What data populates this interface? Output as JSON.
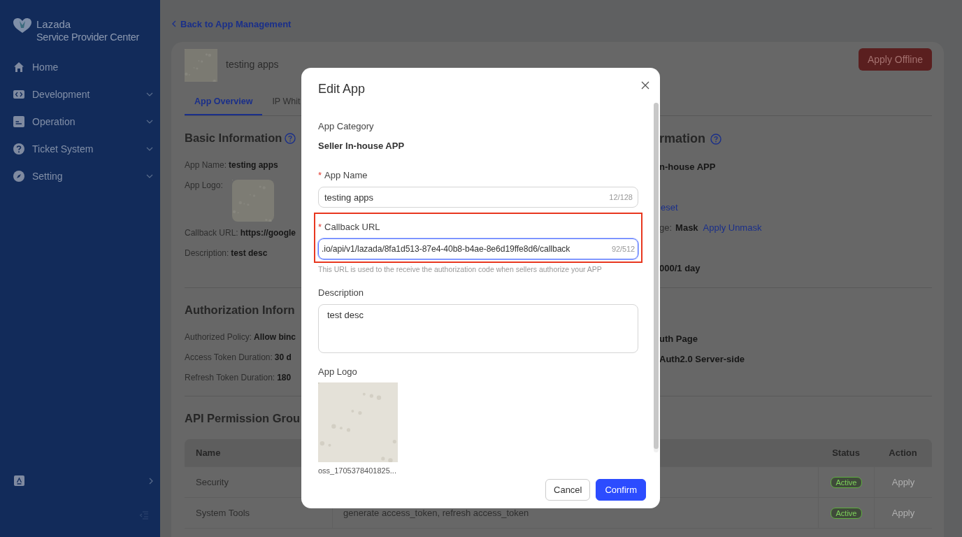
{
  "sidebar": {
    "brand": [
      "Lazada",
      "Service Provider Center"
    ],
    "items": [
      {
        "label": "Home",
        "expandable": false
      },
      {
        "label": "Development",
        "expandable": true
      },
      {
        "label": "Operation",
        "expandable": true
      },
      {
        "label": "Ticket System",
        "expandable": true
      },
      {
        "label": "Setting",
        "expandable": true
      }
    ]
  },
  "back_link": "Back to App Management",
  "app": {
    "name": "testing apps",
    "action": "Apply Offline"
  },
  "tabs": [
    {
      "label": "App Overview",
      "selected": true
    },
    {
      "label": "IP Whit",
      "selected": false
    }
  ],
  "basic_information": {
    "title": "Basic Information",
    "fields": [
      {
        "label": "App Name:",
        "value": "testing apps"
      },
      {
        "label": "App Logo:",
        "kind": "picture"
      },
      {
        "label": "Callback URL:",
        "value": "https://google"
      },
      {
        "label": "Description:",
        "value": "test desc"
      }
    ],
    "right_heading": "rmation",
    "right_rows": [
      {
        "value": "n-house APP"
      },
      {
        "link": "eset"
      },
      {
        "label": "ge:",
        "value": "Mask",
        "link": "Apply Unmask"
      },
      {
        "value": "000/1 day"
      }
    ]
  },
  "authorization": {
    "title": "Authorization Inforn",
    "fields": [
      {
        "label": "Authorized Policy:",
        "value": "Allow binc"
      },
      {
        "label": "Access Token Duration:",
        "value": "30 d"
      },
      {
        "label": "Refresh Token Duration:",
        "value": "180"
      }
    ],
    "right_rows": [
      {
        "value": "uth Page"
      },
      {
        "value": "Auth2.0 Server-side"
      }
    ]
  },
  "api_permissions": {
    "title": "API Permission Grou",
    "columns": [
      "Name",
      "Status",
      "Action"
    ],
    "rows": [
      {
        "name": "Security",
        "status": "Active",
        "action": "Apply",
        "disabled": true
      },
      {
        "name": "System Tools",
        "apis": "generate access_token, refresh access_token",
        "status": "Active",
        "action": "Apply",
        "disabled": true
      }
    ]
  },
  "dialog": {
    "title": "Edit App",
    "category_label": "App Category",
    "category": "Seller In-house APP",
    "fields": [
      {
        "label": "App Name",
        "marker": "*",
        "value": "testing apps",
        "counter": "12/128",
        "focused": false,
        "highlighted": false
      },
      {
        "label": "Callback URL",
        "marker": "*",
        "value": ".io/api/v1/lazada/8fa1d513-87e4-40b8-b4ae-8e6d19ffe8d6/callback",
        "counter": "92/512",
        "focused": true,
        "highlighted": true,
        "hint": "This URL is used to the receive the authorization code when sellers authorize your APP"
      }
    ],
    "description_label": "Description",
    "description": "test desc",
    "logo_label": "App Logo",
    "logo_file": "oss_1705378401825...",
    "buttons": [
      {
        "label": "Cancel",
        "primary": false
      },
      {
        "label": "Confirm",
        "primary": true
      }
    ]
  }
}
